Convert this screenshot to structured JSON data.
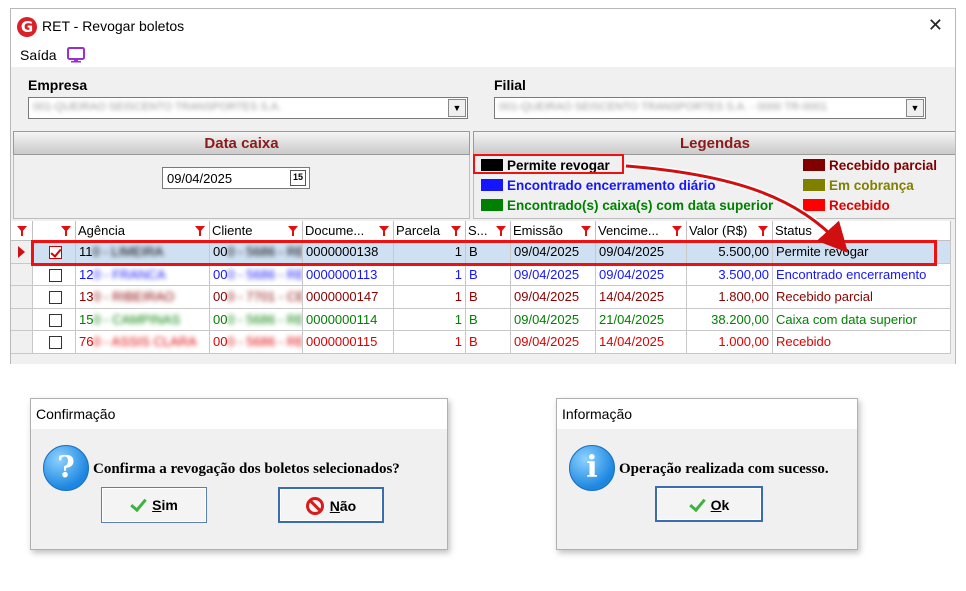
{
  "window": {
    "title": "RET - Revogar boletos",
    "close_glyph": "✕"
  },
  "menu": {
    "saida": "Saída",
    "monitor_icon": "monitor-icon"
  },
  "empresa": {
    "label": "Empresa",
    "value": "001-QUEIRAO SEISCENTO TRANSPORTES S.A."
  },
  "filial": {
    "label": "Filial",
    "value": "001-QUEIRAO SEISCENTO TRANSPORTES S.A. - 0000 TR-0001"
  },
  "data_caixa": {
    "title": "Data caixa",
    "value": "09/04/2025",
    "calendar_glyph": "15"
  },
  "legendas": {
    "title": "Legendas",
    "items": [
      {
        "label": "Permite revogar",
        "color": "#000000"
      },
      {
        "label": "Encontrado encerramento diário",
        "color": "#1515ff"
      },
      {
        "label": "Encontrado(s) caixa(s) com data superior",
        "color": "#008000"
      },
      {
        "label": "Recebido parcial",
        "color": "#800000"
      },
      {
        "label": "Em cobrança",
        "color": "#808000"
      },
      {
        "label": "Recebido",
        "color": "#ff0000"
      }
    ]
  },
  "grid": {
    "columns": [
      "",
      "Agência",
      "Cliente",
      "Docume...",
      "Parcela",
      "S...",
      "Emissão",
      "Vencime...",
      "Valor (R$)",
      "Status"
    ],
    "rows": [
      {
        "selected": true,
        "checked": true,
        "color": "#000000",
        "agencia_prefix": "11",
        "agencia_rest": "0 - LIMEIRA",
        "cliente_prefix": "00",
        "cliente_rest": "0 - 5686 - RE",
        "documento": "0000000138",
        "parcela": "1",
        "situacao": "B",
        "emissao": "09/04/2025",
        "vencimento": "09/04/2025",
        "valor": "5.500,00",
        "status": "Permite revogar"
      },
      {
        "selected": false,
        "checked": false,
        "color": "#1515ff",
        "agencia_prefix": "12",
        "agencia_rest": "0 - FRANCA",
        "cliente_prefix": "00",
        "cliente_rest": "0 - 5686 - RE",
        "documento": "0000000113",
        "parcela": "1",
        "situacao": "B",
        "emissao": "09/04/2025",
        "vencimento": "09/04/2025",
        "valor": "3.500,00",
        "status": "Encontrado encerramento"
      },
      {
        "selected": false,
        "checked": false,
        "color": "#8b0000",
        "agencia_prefix": "13",
        "agencia_rest": "0 - RIBEIRAO",
        "cliente_prefix": "00",
        "cliente_rest": "0 - 7701 - CE",
        "documento": "0000000147",
        "parcela": "1",
        "situacao": "B",
        "emissao": "09/04/2025",
        "vencimento": "14/04/2025",
        "valor": "1.800,00",
        "status": "Recebido parcial"
      },
      {
        "selected": false,
        "checked": false,
        "color": "#008000",
        "agencia_prefix": "15",
        "agencia_rest": "0 - CAMPINAS",
        "cliente_prefix": "00",
        "cliente_rest": "0 - 5686 - RE",
        "documento": "0000000114",
        "parcela": "1",
        "situacao": "B",
        "emissao": "09/04/2025",
        "vencimento": "21/04/2025",
        "valor": "38.200,00",
        "status": "Caixa com data superior"
      },
      {
        "selected": false,
        "checked": false,
        "color": "#e00000",
        "agencia_prefix": "76",
        "agencia_rest": "0 - ASSIS CLARA",
        "cliente_prefix": "00",
        "cliente_rest": "0 - 5686 - RE",
        "documento": "0000000115",
        "parcela": "1",
        "situacao": "B",
        "emissao": "09/04/2025",
        "vencimento": "14/04/2025",
        "valor": "1.000,00",
        "status": "Recebido"
      }
    ]
  },
  "confirm_dialog": {
    "title": "Confirmação",
    "icon": "question-icon",
    "icon_glyph": "?",
    "message": "Confirma a revogação dos boletos selecionados?",
    "yes_underlined": "S",
    "yes_rest": "im",
    "no_underlined": "N",
    "no_rest": "ão"
  },
  "info_dialog": {
    "title": "Informação",
    "icon": "info-icon",
    "icon_glyph": "i",
    "message": "Operação realizada com sucesso.",
    "ok_underlined": "O",
    "ok_rest": "k"
  }
}
